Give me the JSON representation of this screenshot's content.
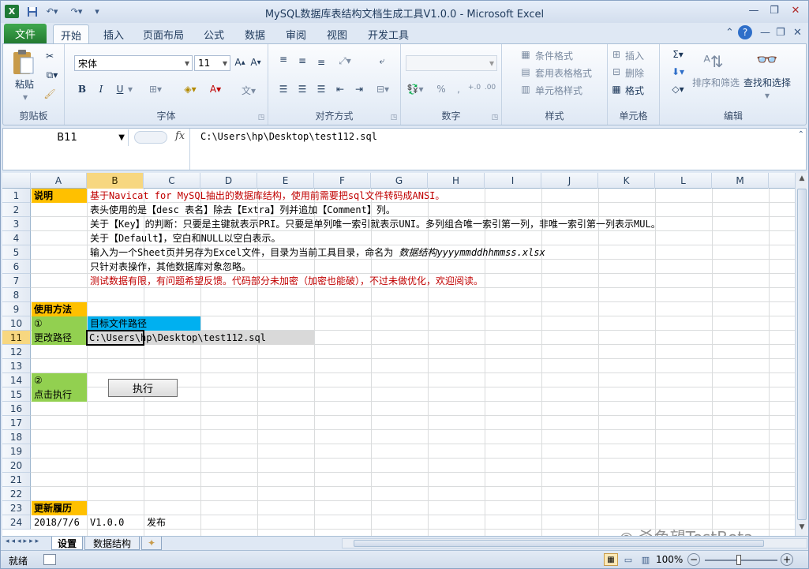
{
  "window": {
    "title": "MySQL数据库表结构文档生成工具V1.0.0 - Microsoft Excel"
  },
  "tabs": {
    "file": "文件",
    "home": "开始",
    "insert": "插入",
    "layout": "页面布局",
    "formulas": "公式",
    "data": "数据",
    "review": "审阅",
    "view": "视图",
    "developer": "开发工具"
  },
  "ribbon": {
    "clipboard": {
      "label": "剪贴板",
      "paste": "粘贴"
    },
    "font": {
      "label": "字体",
      "name": "宋体",
      "size": "11",
      "bold": "B",
      "italic": "I",
      "underline": "U"
    },
    "alignment": {
      "label": "对齐方式"
    },
    "number": {
      "label": "数字"
    },
    "styles": {
      "label": "样式",
      "conditional": "条件格式",
      "table": "套用表格格式",
      "cell": "单元格样式"
    },
    "cells": {
      "label": "单元格",
      "insert": "插入",
      "delete": "删除",
      "format": "格式"
    },
    "editing": {
      "label": "编辑",
      "sort": "排序和筛选",
      "find": "查找和选择"
    }
  },
  "formula_bar": {
    "name_box": "B11",
    "fx": "fx",
    "content": "C:\\Users\\hp\\Desktop\\test112.sql"
  },
  "columns": [
    "A",
    "B",
    "C",
    "D",
    "E",
    "F",
    "G",
    "H",
    "I",
    "J",
    "K",
    "L",
    "M"
  ],
  "rows": [
    "1",
    "2",
    "3",
    "4",
    "5",
    "6",
    "7",
    "8",
    "9",
    "10",
    "11",
    "12",
    "13",
    "14",
    "15",
    "16",
    "17",
    "18",
    "19",
    "20",
    "21",
    "22",
    "23",
    "24"
  ],
  "cells": {
    "a1": "说明",
    "b1": "基于Navicat for MySQL抽出的数据库结构，使用前需要把sql文件转码成ANSI。",
    "b2": "表头使用的是【desc 表名】除去【Extra】列并追加【Comment】列。",
    "b3": "关于【Key】的判断：只要是主键就表示PRI。只要是单列唯一索引就表示UNI。多列组合唯一索引第一列，非唯一索引第一列表示MUL。",
    "b4": "关于【Default】，空白和NULL以空白表示。",
    "b5": "输入为一个Sheet页并另存为Excel文件，目录为当前工具目录，命名为",
    "b5_italic": "数据结构yyyymmddhhmmss.xlsx",
    "b6": "只针对表操作，其他数据库对象忽略。",
    "b7": "测试数据有限，有问题希望反馈。代码部分未加密（加密也能破），不过未做优化，欢迎阅读。",
    "a9": "使用方法",
    "a10": "①",
    "b10": "目标文件路径",
    "a11": "更改路径",
    "b11": "C:\\Users\\hp\\Desktop\\test112.sql",
    "a14": "②",
    "a15": "点击执行",
    "button": "执行",
    "a23": "更新履历",
    "a24": "2018/7/6",
    "b24": "V1.0.0",
    "c24": "发布"
  },
  "sheets": {
    "s1": "设置",
    "s2": "数据结构"
  },
  "status": {
    "ready": "就绪",
    "zoom": "100%"
  },
  "watermark": "杀色望TestBeta",
  "colors": {
    "orange": "#ffc000",
    "green": "#92d050",
    "blue": "#00b0f0",
    "red": "#c00000",
    "excel_green": "#217346"
  }
}
